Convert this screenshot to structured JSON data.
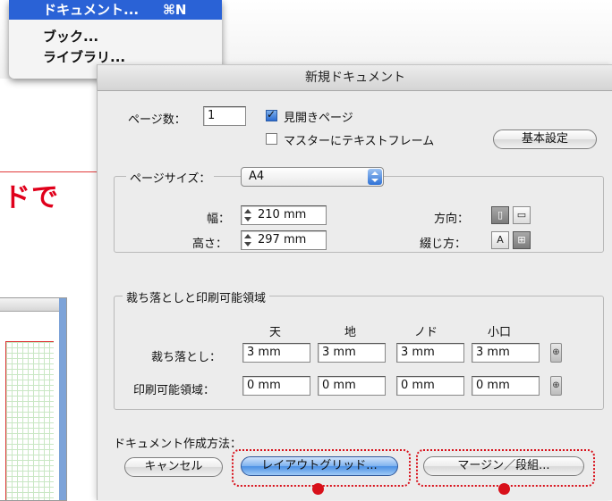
{
  "menu": {
    "items": [
      {
        "label": "ドキュメント...",
        "shortcut": "⌘N"
      },
      {
        "label": "ブック..."
      },
      {
        "label": "ライブラリ..."
      }
    ]
  },
  "background": {
    "partial_heading": "ドで"
  },
  "dialog": {
    "title": "新規ドキュメント",
    "page_count_label": "ページ数：",
    "page_count_value": "1",
    "facing_pages_label": "見開きページ",
    "master_text_frame_label": "マスターにテキストフレーム",
    "basic_settings_button": "基本設定",
    "page_size": {
      "group_label": "ページサイズ：",
      "selected": "A4",
      "width_label": "幅：",
      "width_value": "210 mm",
      "height_label": "高さ：",
      "height_value": "297 mm",
      "orientation_label": "方向：",
      "binding_label": "綴じ方："
    },
    "bleed_slug": {
      "group_label": "裁ち落としと印刷可能領域",
      "columns": [
        "天",
        "地",
        "ノド",
        "小口"
      ],
      "bleed_label": "裁ち落とし：",
      "bleed_values": [
        "3 mm",
        "3 mm",
        "3 mm",
        "3 mm"
      ],
      "slug_label": "印刷可能領域：",
      "slug_values": [
        "0 mm",
        "0 mm",
        "0 mm",
        "0 mm"
      ]
    },
    "creation_method_label": "ドキュメント作成方法：",
    "cancel_button": "キャンセル",
    "layout_grid_button": "レイアウトグリッド...",
    "margin_columns_button": "マージン／段組..."
  },
  "colors": {
    "highlight": "#d8101a",
    "menu_selected": "#2a62d6"
  }
}
